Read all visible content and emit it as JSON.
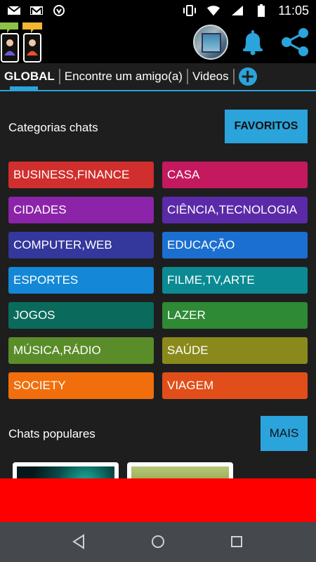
{
  "status_bar": {
    "time": "11:05",
    "icons": [
      "mail-icon",
      "gmail-icon",
      "vpn-icon",
      "vibrate-icon",
      "wifi-icon",
      "signal-icon",
      "battery-icon"
    ]
  },
  "tabs": [
    {
      "label": "GLOBAL",
      "active": true
    },
    {
      "label": "Encontre um amigo(a)",
      "active": false
    },
    {
      "label": "Videos",
      "active": false
    }
  ],
  "add_tab_label": "+",
  "categories_section": {
    "title": "Categorias chats",
    "favorites_label": "FAVORITOS"
  },
  "categories": [
    {
      "label": "BUSINESS,FINANCE",
      "color": "#d12e2e"
    },
    {
      "label": "CASA",
      "color": "#c4195f"
    },
    {
      "label": "CIDADES",
      "color": "#8b24a9"
    },
    {
      "label": "CIÊNCIA,TECNOLOGIA",
      "color": "#5b2aa8"
    },
    {
      "label": "COMPUTER,WEB",
      "color": "#34379c"
    },
    {
      "label": "EDUCAÇÃO",
      "color": "#1b6fd0"
    },
    {
      "label": "ESPORTES",
      "color": "#1487d6"
    },
    {
      "label": "FILME,TV,ARTE",
      "color": "#0b8a93"
    },
    {
      "label": "JOGOS",
      "color": "#0a6b5c"
    },
    {
      "label": "LAZER",
      "color": "#2e8a35"
    },
    {
      "label": "MÚSICA,RÁDIO",
      "color": "#5a8d2a"
    },
    {
      "label": "SAÚDE",
      "color": "#8a8a1c"
    },
    {
      "label": "SOCIETY",
      "color": "#f06f0c"
    },
    {
      "label": "VIAGEM",
      "color": "#e14e1a"
    }
  ],
  "popular_section": {
    "title": "Chats populares",
    "more_label": "MAIS"
  },
  "colors": {
    "accent": "#2ba3db",
    "background": "#1e1e1e",
    "ad_banner": "#ff0000"
  }
}
